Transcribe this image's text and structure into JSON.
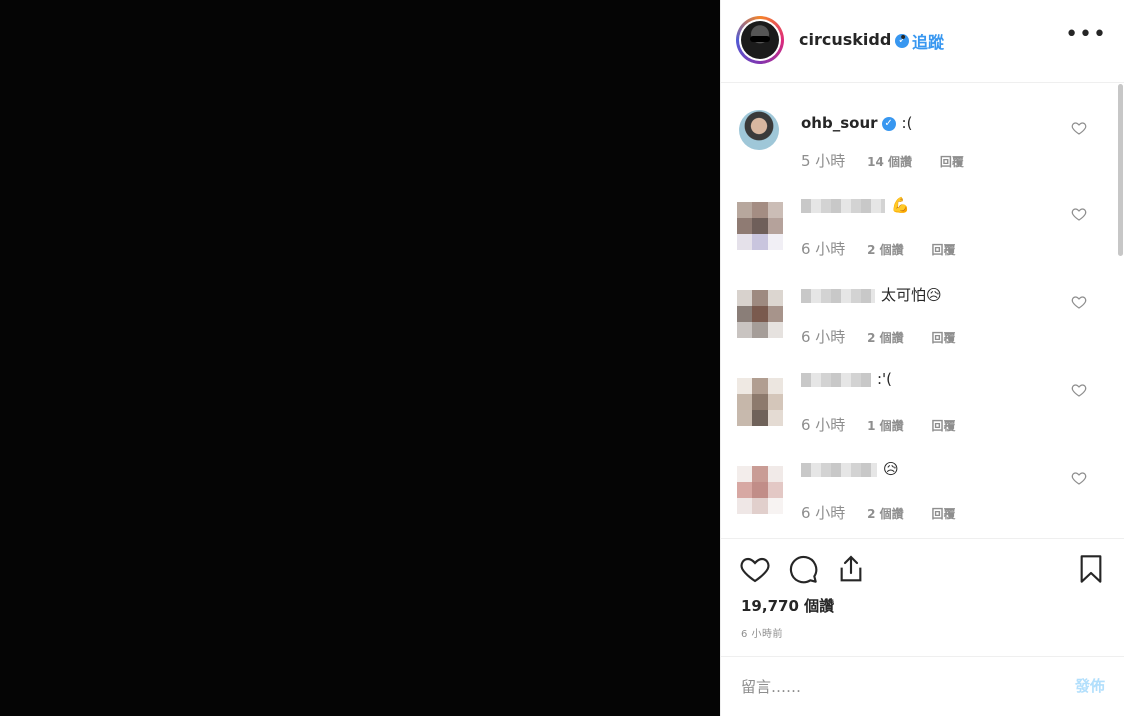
{
  "post": {
    "username": "circuskidd",
    "verified": true,
    "dot": "•",
    "follow_label": "追蹤",
    "more_label": "•••",
    "likes_count": "19,770 個讚",
    "time_ago": "6 小時前"
  },
  "comments": [
    {
      "username": "ohb_sour",
      "verified": true,
      "text": ":(",
      "time": "5 小時",
      "likes": "14 個讚",
      "reply": "回覆"
    },
    {
      "username": "",
      "text": "💪",
      "time": "6 小時",
      "likes": "2 個讚",
      "reply": "回覆"
    },
    {
      "username": "",
      "text": "太可怕😥",
      "time": "6 小時",
      "likes": "2 個讚",
      "reply": "回覆"
    },
    {
      "username": "",
      "text": ":'(",
      "time": "6 小時",
      "likes": "1 個讚",
      "reply": "回覆"
    },
    {
      "username": "",
      "text": "😥",
      "time": "6 小時",
      "likes": "2 個讚",
      "reply": "回覆"
    }
  ],
  "composer": {
    "placeholder": "留言……",
    "post_label": "發佈"
  },
  "colors": {
    "accent": "#3897f0",
    "disabled_post": "#b2dffc",
    "meta_text": "#8e8e8e"
  },
  "icons": {
    "verified": "verified-badge-icon",
    "heart": "heart-icon",
    "comment": "comment-icon",
    "share": "share-icon",
    "bookmark": "bookmark-icon",
    "more": "more-options-icon"
  }
}
